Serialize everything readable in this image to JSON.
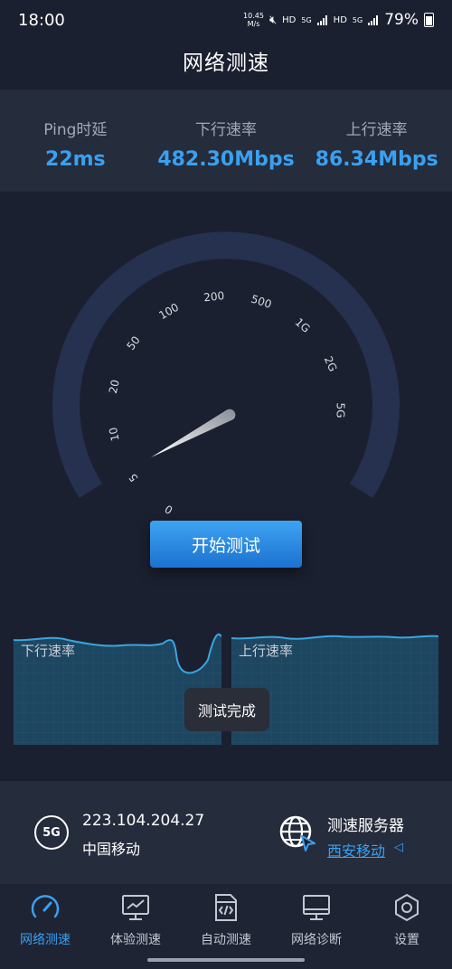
{
  "status_bar": {
    "time": "18:00",
    "net_speed_value": "10.45",
    "net_speed_unit": "M/s",
    "hd1": "HD",
    "net1": "5G",
    "hd2": "HD",
    "net2": "5G",
    "battery": "79%"
  },
  "title": "网络测速",
  "stats": {
    "ping_label": "Ping时延",
    "ping_value": "22ms",
    "download_label": "下行速率",
    "download_value": "482.30Mbps",
    "upload_label": "上行速率",
    "upload_value": "86.34Mbps"
  },
  "gauge": {
    "labels": [
      "0",
      "5",
      "10",
      "20",
      "50",
      "100",
      "200",
      "500",
      "1G",
      "2G",
      "5G"
    ]
  },
  "start_button": "开始测试",
  "charts": {
    "download_label": "下行速率",
    "upload_label": "上行速率",
    "toast": "测试完成"
  },
  "info": {
    "network_badge": "5G",
    "ip": "223.104.204.27",
    "carrier": "中国移动",
    "server_title": "测速服务器",
    "server_name": "西安移动"
  },
  "nav": {
    "items": [
      {
        "label": "网络测速",
        "icon": "speedometer-icon",
        "active": true
      },
      {
        "label": "体验测速",
        "icon": "monitor-chart-icon",
        "active": false
      },
      {
        "label": "自动测速",
        "icon": "code-file-icon",
        "active": false
      },
      {
        "label": "网络诊断",
        "icon": "desktop-icon",
        "active": false
      },
      {
        "label": "设置",
        "icon": "hexagon-settings-icon",
        "active": false
      }
    ]
  },
  "colors": {
    "accent": "#3aa0f0",
    "background": "#1b2030",
    "panel": "#252c3c",
    "gauge_arc": "#25314f"
  }
}
